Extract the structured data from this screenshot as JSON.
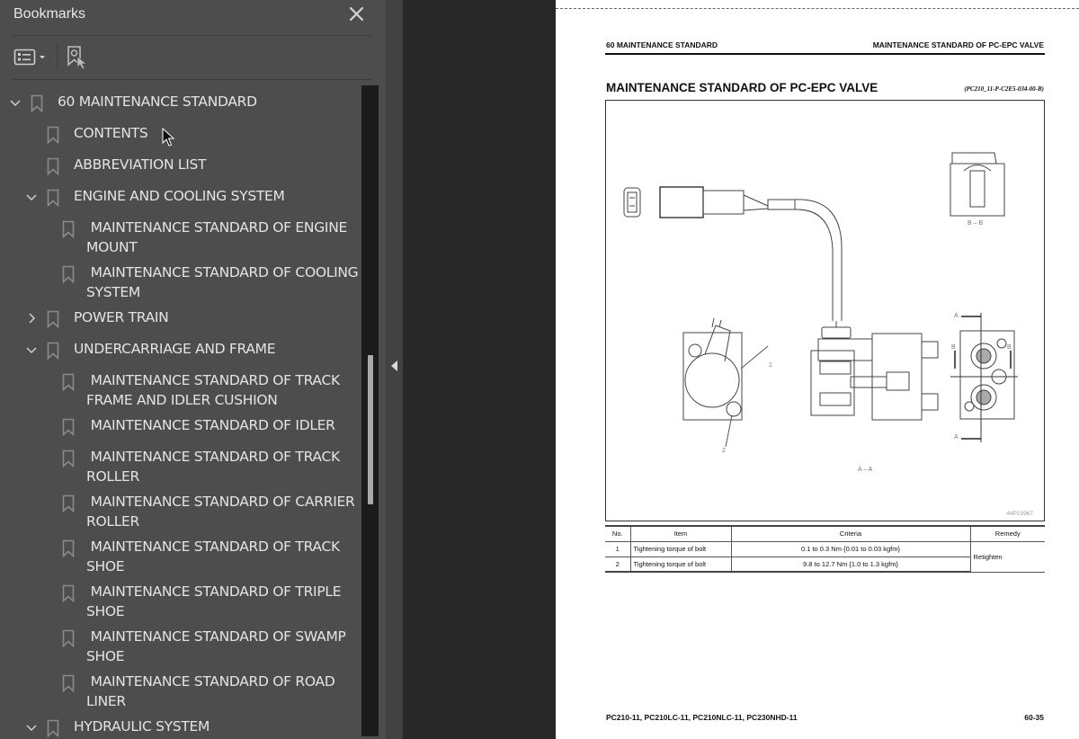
{
  "panel": {
    "title": "Bookmarks",
    "close_icon": "close-icon",
    "toolbar": [
      {
        "name": "bookmark-options-dropdown",
        "icon": "list-options-icon"
      },
      {
        "name": "find-current-bookmark-button",
        "icon": "bookmark-search-icon"
      }
    ]
  },
  "bookmarks": [
    {
      "level": 0,
      "expander": "expanded",
      "label": "60 MAINTENANCE STANDARD"
    },
    {
      "level": 1,
      "expander": "none",
      "label": "CONTENTS"
    },
    {
      "level": 1,
      "expander": "none",
      "label": "ABBREVIATION LIST"
    },
    {
      "level": 1,
      "expander": "expanded",
      "label": "ENGINE AND COOLING SYSTEM"
    },
    {
      "level": 2,
      "expander": "none",
      "label": " MAINTENANCE STANDARD OF ENGINE\nMOUNT"
    },
    {
      "level": 2,
      "expander": "none",
      "label": " MAINTENANCE STANDARD OF COOLING\nSYSTEM"
    },
    {
      "level": 1,
      "expander": "collapsed",
      "label": "POWER TRAIN"
    },
    {
      "level": 1,
      "expander": "expanded",
      "label": "UNDERCARRIAGE AND FRAME"
    },
    {
      "level": 2,
      "expander": "none",
      "label": " MAINTENANCE STANDARD OF TRACK\nFRAME AND IDLER CUSHION"
    },
    {
      "level": 2,
      "expander": "none",
      "label": " MAINTENANCE STANDARD OF IDLER"
    },
    {
      "level": 2,
      "expander": "none",
      "label": " MAINTENANCE STANDARD OF TRACK\nROLLER"
    },
    {
      "level": 2,
      "expander": "none",
      "label": " MAINTENANCE STANDARD OF CARRIER\nROLLER"
    },
    {
      "level": 2,
      "expander": "none",
      "label": " MAINTENANCE STANDARD OF TRACK\nSHOE"
    },
    {
      "level": 2,
      "expander": "none",
      "label": " MAINTENANCE STANDARD OF TRIPLE\nSHOE"
    },
    {
      "level": 2,
      "expander": "none",
      "label": " MAINTENANCE STANDARD OF SWAMP\nSHOE"
    },
    {
      "level": 2,
      "expander": "none",
      "label": " MAINTENANCE STANDARD OF ROAD\nLINER"
    },
    {
      "level": 1,
      "expander": "expanded",
      "label": "HYDRAULIC SYSTEM"
    }
  ],
  "page": {
    "header_left": "60 MAINTENANCE STANDARD",
    "header_right": "MAINTENANCE STANDARD OF PC-EPC VALVE",
    "title": "MAINTENANCE STANDARD OF PC-EPC VALVE",
    "doc_code": "(PC210_11-P-C2E5-034-00-B)",
    "figure": {
      "view_bb": "B – B",
      "view_aa": "A – A",
      "callout_1": "1",
      "callout_2": "2",
      "section_a": "A",
      "section_b": "B",
      "figure_id": "44P15967"
    },
    "table": {
      "headers": [
        "No.",
        "Item",
        "Criteria",
        "Remedy"
      ],
      "rows": [
        {
          "no": "1",
          "item": "Tightening torque of bolt",
          "criteria": "0.1 to 0.3 Nm {0.01 to 0.03 kgfm}"
        },
        {
          "no": "2",
          "item": "Tightening torque of bolt",
          "criteria": "9.8 to 12.7 Nm {1.0 to 1.3 kgfm}"
        }
      ],
      "remedy": "Retighten"
    },
    "footer_left": "PC210-11, PC210LC-11, PC210NLC-11, PC230NHD-11",
    "footer_right": "60-35"
  },
  "colors": {
    "panel_bg": "#4d4d4d",
    "doc_bg": "#282828",
    "page_bg": "#ffffff",
    "text_light": "#e4e4e4"
  }
}
